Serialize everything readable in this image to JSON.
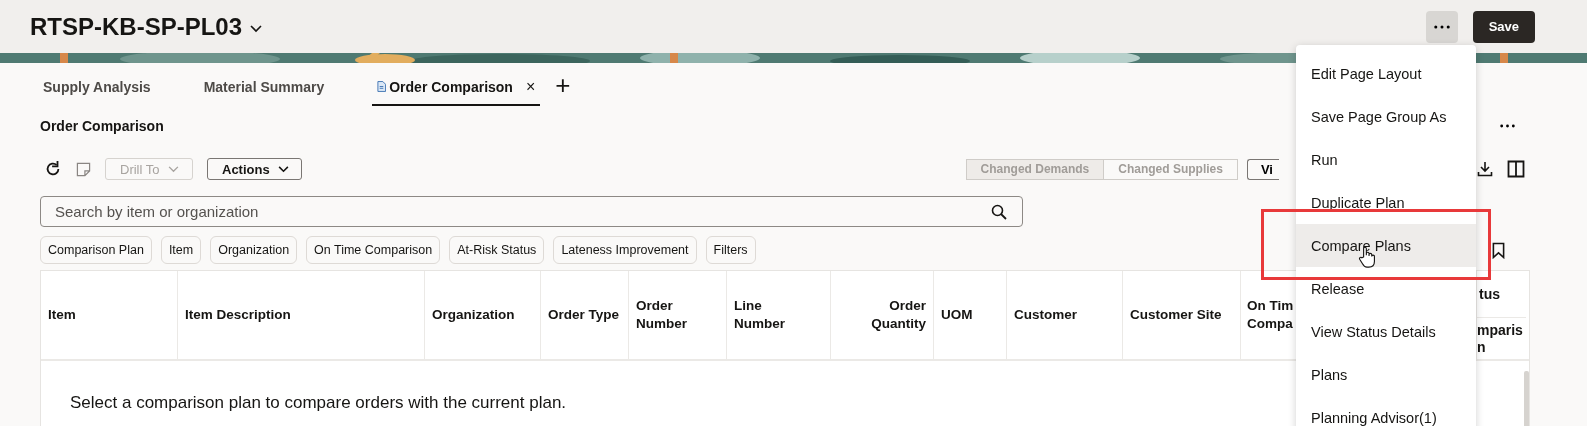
{
  "header": {
    "title": "RTSP-KB-SP-PL03",
    "save_button": "Save"
  },
  "tabs": [
    {
      "label": "Supply Analysis",
      "selected": false,
      "closable": false
    },
    {
      "label": "Material Summary",
      "selected": false,
      "closable": false
    },
    {
      "label": "Order Comparison",
      "selected": true,
      "closable": true,
      "close": "×"
    }
  ],
  "add_tab": "+",
  "section": {
    "title": "Order Comparison"
  },
  "toolbar": {
    "drill_to": {
      "label": "Drill To",
      "disabled": true
    },
    "actions": "Actions",
    "segments": [
      {
        "label": "Changed Demands",
        "selected": true
      },
      {
        "label": "Changed Supplies",
        "selected": false
      }
    ],
    "view_button": "Vi"
  },
  "search": {
    "placeholder": "Search by item or organization"
  },
  "filter_chips": [
    "Comparison Plan",
    "Item",
    "Organization",
    "On Time Comparison",
    "At-Risk Status",
    "Lateness Improvement",
    "Filters"
  ],
  "table": {
    "columns": [
      {
        "label": "Item"
      },
      {
        "label": "Item Description"
      },
      {
        "label": "Organization"
      },
      {
        "label": "Order Type"
      },
      {
        "label": "Order\nNumber"
      },
      {
        "label": "Line\nNumber"
      },
      {
        "label": "Order\nQuantity"
      },
      {
        "label": "UOM"
      },
      {
        "label": "Customer"
      },
      {
        "label": "Customer Site"
      },
      {
        "label": "On Tim\nCompa"
      },
      {
        "group": "tus",
        "label": "mparis\nn"
      }
    ],
    "empty_message": "Select a comparison plan to compare orders with the current plan."
  },
  "menu": {
    "items": [
      {
        "label": "Edit Page Layout",
        "hovered": false
      },
      {
        "label": "Save Page Group As",
        "hovered": false
      },
      {
        "label": "Run",
        "hovered": false
      },
      {
        "label": "Duplicate Plan",
        "hovered": false
      },
      {
        "label": "Compare Plans",
        "hovered": true
      },
      {
        "label": "Release",
        "hovered": false
      },
      {
        "label": "View Status Details",
        "hovered": false
      },
      {
        "label": "Plans",
        "hovered": false
      },
      {
        "label": "Planning Advisor(1)",
        "hovered": false
      }
    ]
  }
}
